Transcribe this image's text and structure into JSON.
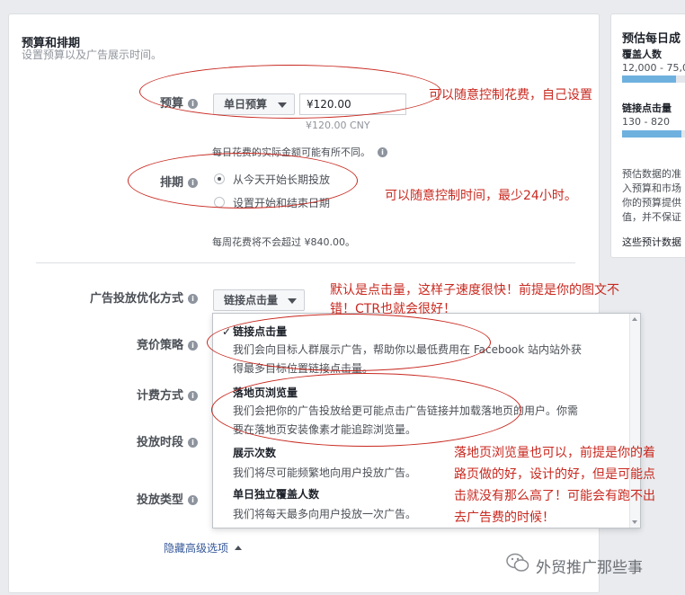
{
  "section": {
    "title": "预算和排期",
    "subtitle": "设置预算以及广告展示时间。"
  },
  "budget": {
    "label": "预算",
    "type_label": "单日预算",
    "amount": "¥120.00",
    "converted": "¥120.00 CNY",
    "note": "每日花费的实际金额可能有所不同。"
  },
  "schedule": {
    "label": "排期",
    "option1": "从今天开始长期投放",
    "option2": "设置开始和结束日期",
    "weekly_note": "每周花费将不会超过 ¥840.00。"
  },
  "optimization": {
    "label": "广告投放优化方式",
    "selected": "链接点击量"
  },
  "form_labels": {
    "bid_strategy": "竞价策略",
    "billing": "计费方式",
    "delivery_time": "投放时段",
    "delivery_type": "投放类型"
  },
  "dropdown": {
    "options": [
      {
        "title": "链接点击量",
        "desc1": "我们会向目标人群展示广告，帮助你以最低费用在 Facebook 站内站外获",
        "desc2": "得最多目标位置链接点击量。",
        "check": "✓"
      },
      {
        "title": "落地页浏览量",
        "desc1": "我们会把你的广告投放给更可能点击广告链接并加载落地页的用户。你需",
        "desc2": "要在落地页安装像素才能追踪浏览量。"
      },
      {
        "title": "展示次数",
        "desc1": "我们将尽可能频繁地向用户投放广告。"
      },
      {
        "title": "单日独立覆盖人数",
        "desc1": "我们将每天最多向用户投放一次广告。"
      }
    ]
  },
  "hide_advanced": "隐藏高级选项",
  "side_panel": {
    "title": "预估每日成",
    "reach_label": "覆盖人数",
    "reach_value": "12,000 - 75,0",
    "clicks_label": "链接点击量",
    "clicks_value": "130 - 820",
    "note_lines": [
      "预估数据的准",
      "入预算和市场",
      "你的预算提供",
      "值，并不保证"
    ],
    "link": "这些预计数据"
  },
  "annotations": {
    "a1": "可以随意控制花费，自己设置",
    "a2": "可以随意控制时间，最少24小时。",
    "a3_line1": "默认是点击量，这样子速度很快！前提是你的图文不",
    "a3_line2": "错！CTR也就会很好！",
    "a4_lines": [
      "落地页浏览量也可以，前提是你的着",
      "路页做的好，设计的好，但是可能点",
      "击就没有那么高了！可能会有跑不出",
      "去广告费的时候！"
    ]
  },
  "watermark": "外贸推广那些事",
  "info_glyph": "i",
  "colors": {
    "annotation": "#c8281f",
    "bar": "#6fb1de"
  }
}
